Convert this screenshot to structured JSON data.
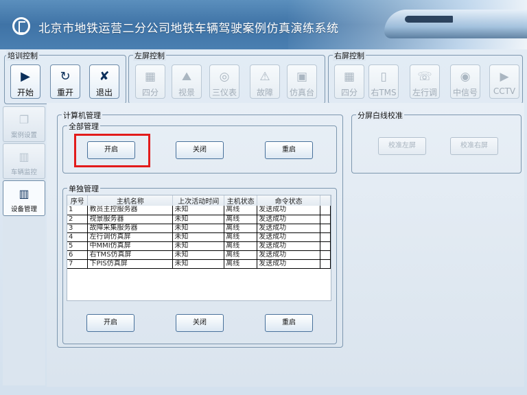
{
  "app": {
    "title": "北京市地铁运营二分公司地铁车辆驾驶案例仿真演练系统"
  },
  "training_control": {
    "title": "培训控制",
    "buttons": [
      {
        "label": "开始",
        "icon": "play-icon"
      },
      {
        "label": "重开",
        "icon": "restart-icon"
      },
      {
        "label": "退出",
        "icon": "exit-icon"
      }
    ]
  },
  "left_screen_control": {
    "title": "左屏控制",
    "buttons": [
      {
        "label": "四分",
        "icon": "quad-split-icon"
      },
      {
        "label": "视景",
        "icon": "scene-icon"
      },
      {
        "label": "三仪表",
        "icon": "gauge-icon"
      },
      {
        "label": "故障",
        "icon": "warning-icon"
      },
      {
        "label": "仿真台",
        "icon": "console-icon"
      }
    ]
  },
  "right_screen_control": {
    "title": "右屏控制",
    "buttons": [
      {
        "label": "四分",
        "icon": "quad-split-icon"
      },
      {
        "label": "右TMS",
        "icon": "tms-icon"
      },
      {
        "label": "左行调",
        "icon": "dispatch-icon"
      },
      {
        "label": "中信号",
        "icon": "signal-icon"
      },
      {
        "label": "CCTV",
        "icon": "camera-icon"
      }
    ]
  },
  "sidebar": {
    "items": [
      {
        "label": "案例设置",
        "icon": "case-settings-icon",
        "active": false
      },
      {
        "label": "车辆监控",
        "icon": "vehicle-monitor-icon",
        "active": false
      },
      {
        "label": "设备管理",
        "icon": "device-management-icon",
        "active": true
      }
    ]
  },
  "computer_management": {
    "title": "计算机管理",
    "all": {
      "title": "全部管理",
      "start_label": "开启",
      "close_label": "关闭",
      "restart_label": "重启"
    },
    "single": {
      "title": "单独管理",
      "columns": [
        "序号",
        "主机名称",
        "上次活动时间",
        "主机状态",
        "命令状态"
      ],
      "rows": [
        [
          "1",
          "教员主控服务器",
          "未知",
          "离线",
          "发送成功"
        ],
        [
          "2",
          "视景服务器",
          "未知",
          "离线",
          "发送成功"
        ],
        [
          "3",
          "故障采集服务器",
          "未知",
          "离线",
          "发送成功"
        ],
        [
          "4",
          "左行调仿真屏",
          "未知",
          "离线",
          "发送成功"
        ],
        [
          "5",
          "中MMI仿真屏",
          "未知",
          "离线",
          "发送成功"
        ],
        [
          "6",
          "右TMS仿真屏",
          "未知",
          "离线",
          "发送成功"
        ],
        [
          "7",
          "下PIS仿真屏",
          "未知",
          "离线",
          "发送成功"
        ]
      ],
      "start_label": "开启",
      "close_label": "关闭",
      "restart_label": "重启"
    }
  },
  "split_screen_calibration": {
    "title": "分屏白线校准",
    "calibrate_left_label": "校准左屏",
    "calibrate_right_label": "校准右屏"
  },
  "colors": {
    "accent": "#3f73a6",
    "highlight": "#e21b1b"
  }
}
